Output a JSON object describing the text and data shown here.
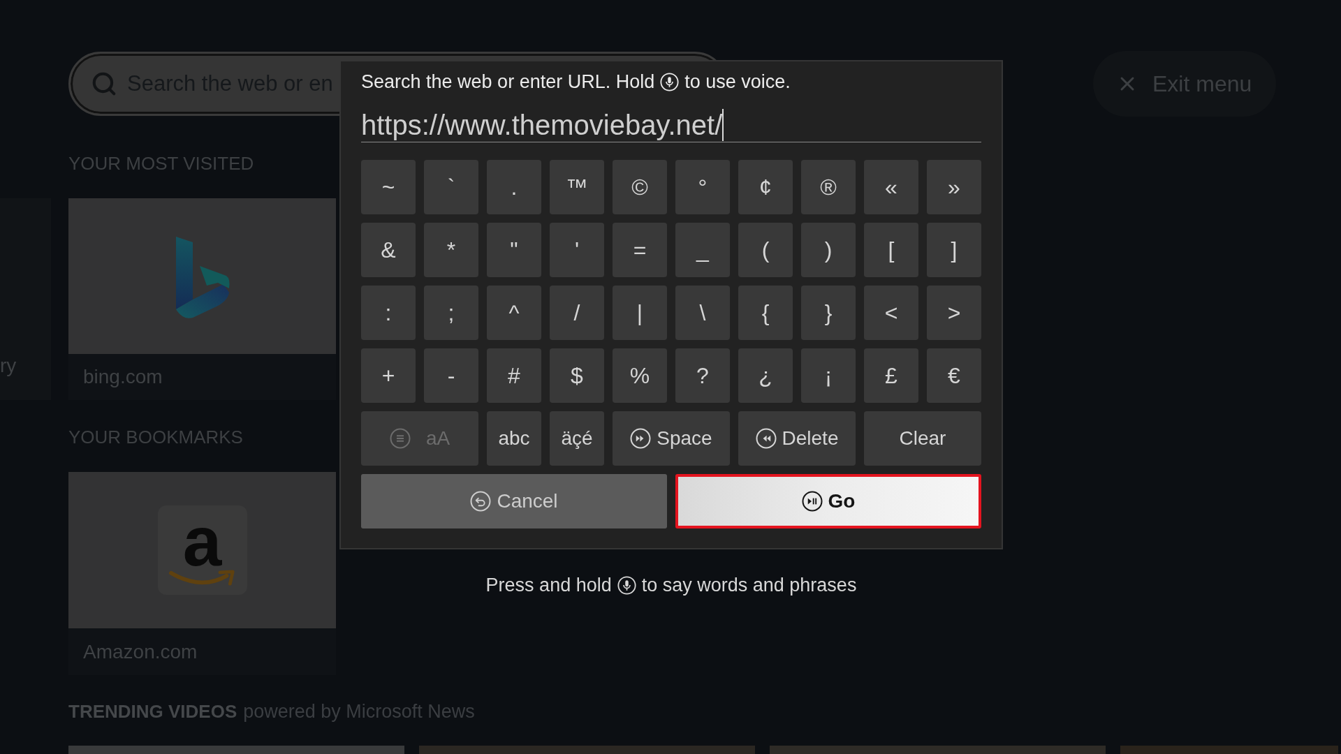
{
  "search_bar": {
    "placeholder": "Search the web or en"
  },
  "exit_button": {
    "label": "Exit menu"
  },
  "most_visited": {
    "heading": "YOUR MOST VISITED",
    "partial_tile": {
      "label": "ry"
    },
    "tiles": [
      {
        "label": "bing.com"
      }
    ]
  },
  "bookmarks": {
    "heading": "YOUR BOOKMARKS",
    "tiles": [
      {
        "label": "Amazon.com",
        "logo_letter": "a"
      }
    ]
  },
  "trending_videos": {
    "heading": "TRENDING VIDEOS",
    "source": "powered by Microsoft News"
  },
  "url_dialog": {
    "prompt_start": "Search the web or enter URL. Hold",
    "prompt_end": "to use voice.",
    "url_field": {
      "value": "https://www.themoviebay.net/"
    },
    "symbol_rows": [
      [
        "~",
        "`",
        ".",
        "™",
        "©",
        "°",
        "¢",
        "®",
        "«",
        "»"
      ],
      [
        "&",
        "*",
        "\"",
        "'",
        "=",
        "_",
        "(",
        ")",
        "[",
        "]"
      ],
      [
        ":",
        ";",
        "^",
        "/",
        "|",
        "\\",
        "{",
        "}",
        "<",
        ">"
      ],
      [
        "+",
        "-",
        "#",
        "$",
        "%",
        "?",
        "¿",
        "¡",
        "£",
        "€"
      ]
    ],
    "function_keys": [
      {
        "kind": "case",
        "label": "aA",
        "disabled": true
      },
      {
        "kind": "letters",
        "label": "abc",
        "disabled": false
      },
      {
        "kind": "accents",
        "label": "äçé",
        "disabled": false
      },
      {
        "kind": "space",
        "label": "Space",
        "disabled": false
      },
      {
        "kind": "delete",
        "label": "Delete",
        "disabled": false
      },
      {
        "kind": "clear",
        "label": "Clear",
        "disabled": false
      }
    ],
    "actions": [
      {
        "kind": "cancel",
        "label": "Cancel",
        "selected": false
      },
      {
        "kind": "go",
        "label": "Go",
        "selected": true
      }
    ]
  },
  "voice_hint": {
    "start": "Press and hold",
    "end": "to say words and phrases"
  }
}
